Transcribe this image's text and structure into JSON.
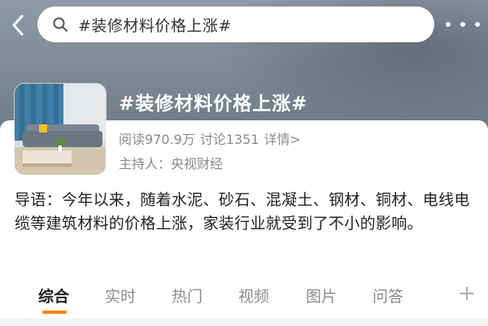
{
  "search": {
    "query": "#装修材料价格上涨#"
  },
  "topic": {
    "title": "#装修材料价格上涨#",
    "reads": "阅读970.9万",
    "discussions": "讨论1351",
    "details": "详情>",
    "host": "主持人：央视财经"
  },
  "intro": {
    "text": "导语：今年以来，随着水泥、砂石、混凝土、钢材、铜材、电线电缆等建筑材料的价格上涨，家装行业就受到了不小的影响。"
  },
  "tabs": [
    {
      "label": "综合",
      "active": true
    },
    {
      "label": "实时",
      "active": false
    },
    {
      "label": "热门",
      "active": false
    },
    {
      "label": "视频",
      "active": false
    },
    {
      "label": "图片",
      "active": false
    },
    {
      "label": "问答",
      "active": false
    }
  ],
  "colors": {
    "accent": "#ff8200",
    "header_bg": "#8a96a2",
    "muted_text": "#8a8a8a"
  },
  "icons": {
    "back": "chevron-left-icon",
    "search": "search-icon",
    "more": "more-dots-icon",
    "add_tab": "plus-icon"
  }
}
